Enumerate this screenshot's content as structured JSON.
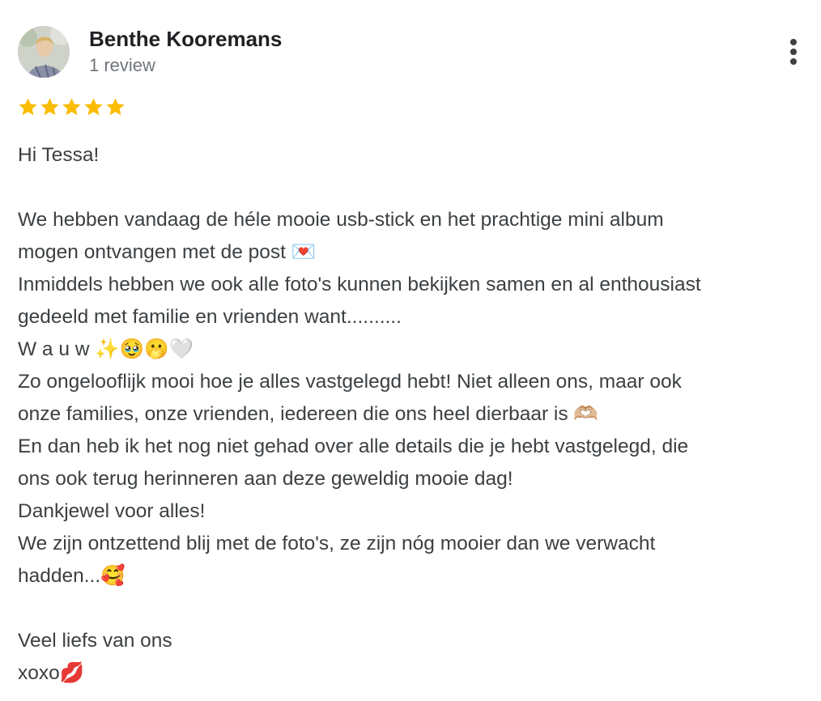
{
  "reviewer": {
    "name": "Benthe Kooremans",
    "review_count": "1 review",
    "avatar_icon": "profile-photo"
  },
  "menu": {
    "icon": "more-vert-icon"
  },
  "rating": {
    "stars": 5,
    "max": 5,
    "color": "#fbbc04"
  },
  "review_text": {
    "greeting": "Hi Tessa!",
    "line1": "We hebben vandaag de héle mooie usb-stick en het prachtige mini album",
    "line2": "mogen ontvangen met de post 💌",
    "line3": "Inmiddels hebben we ook alle foto's kunnen bekijken samen en al enthousiast",
    "line4": "gedeeld met familie en vrienden want..........",
    "line5": "W a u w ✨🥹🫢🤍",
    "line6": "Zo ongelooflijk mooi hoe je alles vastgelegd hebt! Niet alleen ons, maar ook",
    "line7": "onze families, onze vrienden, iedereen die ons heel dierbaar is 🫶🏼",
    "line8": "En dan heb ik het nog niet gehad over alle details die je hebt vastgelegd, die",
    "line9": "ons ook terug herinneren aan deze geweldig mooie dag!",
    "line10": "Dankjewel voor alles!",
    "line11": "We zijn ontzettend blij met de foto's, ze zijn nóg mooier dan we verwacht",
    "line12": "hadden...🥰",
    "closing1": "Veel liefs van ons",
    "closing2": "xoxo💋"
  }
}
